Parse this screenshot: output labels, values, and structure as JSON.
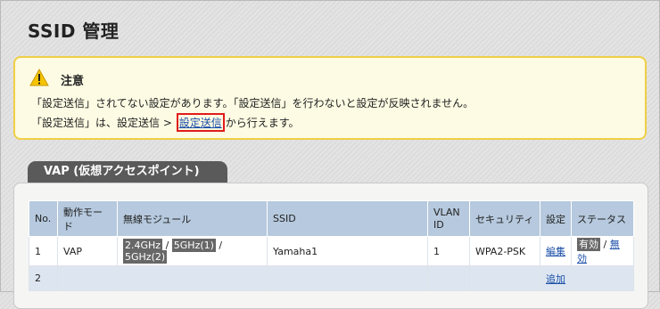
{
  "page": {
    "title": "SSID 管理"
  },
  "notice": {
    "title": "注意",
    "line1": "「設定送信」されてない設定があります。「設定送信」を行わないと設定が反映されません。",
    "line2_prefix": "「設定送信」は、設定送信 > ",
    "line2_link": "設定送信",
    "line2_suffix": "から行えます。"
  },
  "vap": {
    "tab_label": "VAP (仮想アクセスポイント)",
    "headers": {
      "no": "No.",
      "mode": "動作モード",
      "module": "無線モジュール",
      "ssid": "SSID",
      "vlan_line1": "VLAN",
      "vlan_line2": "ID",
      "security": "セキュリティ",
      "setting": "設定",
      "status": "ステータス"
    },
    "rows": [
      {
        "no": "1",
        "mode": "VAP",
        "module_a": "2.4GHz",
        "module_b": "5GHz(1)",
        "module_c": "5GHz(2)",
        "separator": " / ",
        "ssid": "Yamaha1",
        "vlan": "1",
        "security": "WPA2-PSK",
        "setting": "編集",
        "status_a": "有効",
        "status_b": "無効"
      },
      {
        "no": "2",
        "setting": "追加"
      }
    ]
  }
}
